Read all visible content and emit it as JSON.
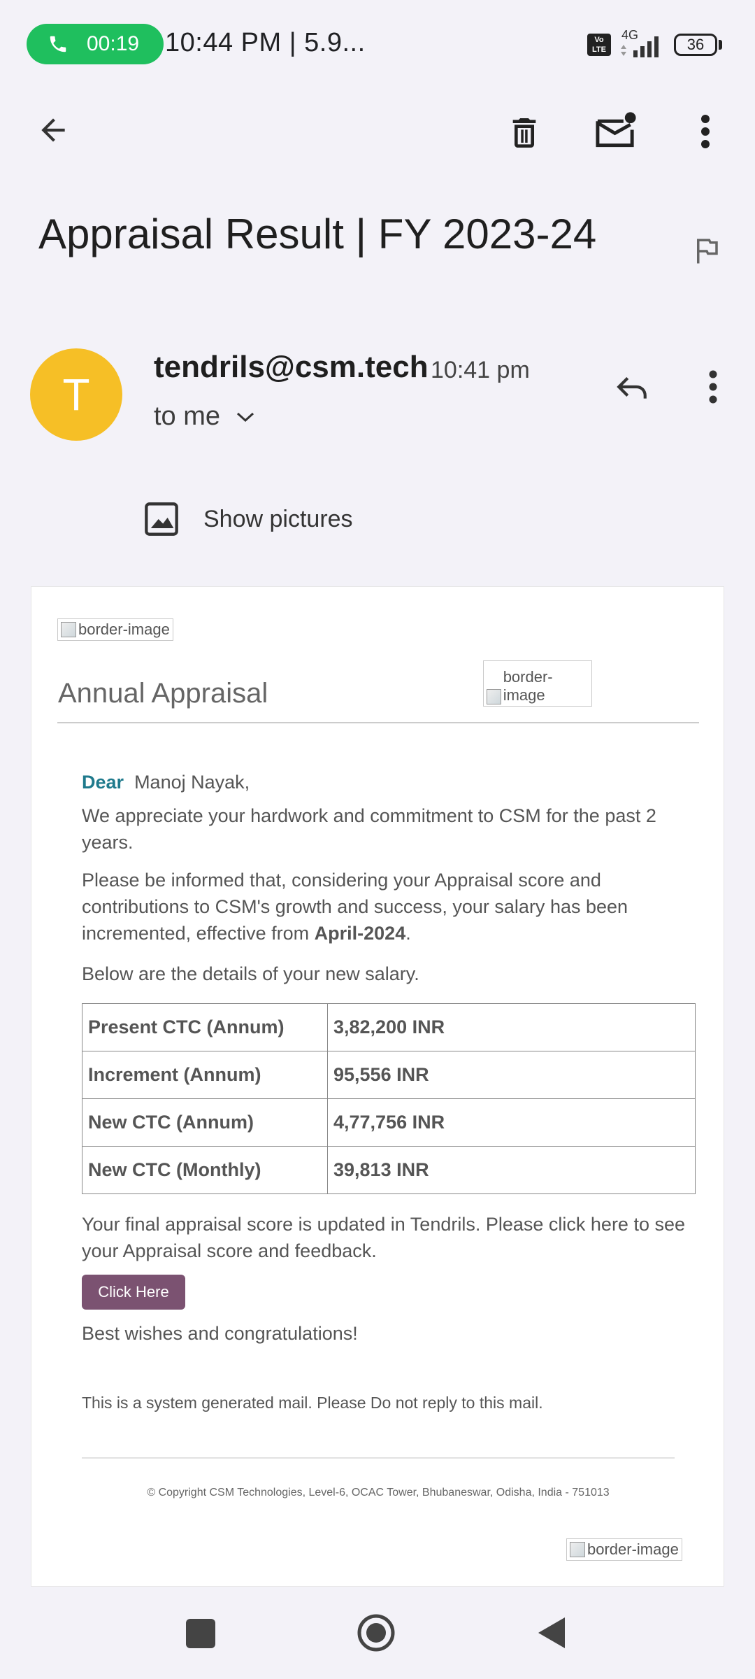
{
  "status_bar": {
    "call_duration": "00:19",
    "time": "10:44 PM | 5.9...",
    "network": "4G",
    "volte": "Vo LTE",
    "battery": "36"
  },
  "toolbar": {
    "back_icon": "arrow-left-icon",
    "delete_icon": "trash-icon",
    "mark_unread_icon": "mail-unread-icon",
    "more_icon": "more-vert-icon"
  },
  "email": {
    "subject": "Appraisal Result | FY 2023-24",
    "sender_initial": "T",
    "sender": "tendrils@csm.tech",
    "time": "10:41 pm",
    "recipient": "to me",
    "show_pictures": "Show pictures"
  },
  "body": {
    "alt_border_image": "border-image",
    "heading": "Annual Appraisal",
    "dear": "Dear",
    "name": "Manoj Nayak,",
    "para1": "We appreciate your hardwork and commitment to CSM for the past 2 years.",
    "para2_a": "Please be informed that, considering your Appraisal score and contributions to CSM's growth and success, your salary has been incremented, effective from ",
    "para2_bold": "April-2024",
    "para2_end": ".",
    "para3": "Below are the details of your new salary.",
    "table": [
      {
        "label": "Present CTC (Annum)",
        "value": "3,82,200 INR"
      },
      {
        "label": "Increment (Annum)",
        "value": "95,556 INR"
      },
      {
        "label": "New CTC (Annum)",
        "value": "4,77,756 INR"
      },
      {
        "label": "New CTC (Monthly)",
        "value": "39,813 INR"
      }
    ],
    "para4": "Your final appraisal score is updated in Tendrils. Please click here to see your Appraisal score and feedback.",
    "button": "Click Here",
    "wishes": "Best wishes and congratulations!",
    "system_note": "This is a system generated mail. Please Do not reply to this mail.",
    "copyright": "© Copyright CSM Technologies, Level-6, OCAC Tower, Bhubaneswar, Odisha, India - 751013"
  },
  "colors": {
    "avatar": "#f6bf26",
    "call_pill": "#1fbf5e",
    "button": "#7b5271",
    "dear": "#1f7a8c"
  }
}
